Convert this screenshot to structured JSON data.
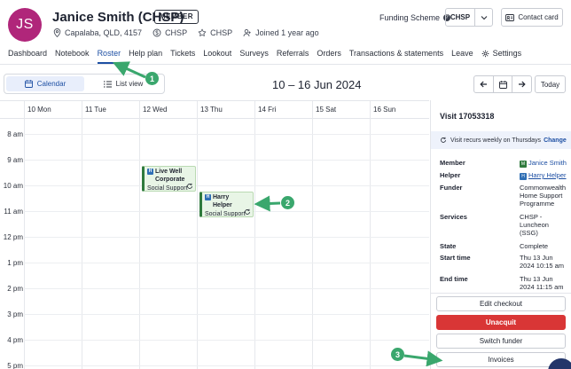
{
  "header": {
    "avatar_initials": "JS",
    "client_name": "Janice Smith (CHSP)",
    "member_badge": "MEMBER",
    "location": "Capalaba, QLD, 4157",
    "program_1": "CHSP",
    "program_2": "CHSP",
    "joined": "Joined 1 year ago",
    "funding_scheme_label": "Funding Scheme",
    "funding_scheme_value": "CHSP",
    "contact_card_label": "Contact card"
  },
  "tabs": [
    {
      "label": "Dashboard"
    },
    {
      "label": "Notebook"
    },
    {
      "label": "Roster",
      "active": true
    },
    {
      "label": "Help plan"
    },
    {
      "label": "Tickets"
    },
    {
      "label": "Lookout"
    },
    {
      "label": "Surveys"
    },
    {
      "label": "Referrals"
    },
    {
      "label": "Orders"
    },
    {
      "label": "Transactions & statements"
    },
    {
      "label": "Leave"
    },
    {
      "label": "Settings"
    }
  ],
  "toolbar": {
    "calendar_label": "Calendar",
    "list_view_label": "List view",
    "date_range": "10 – 16 Jun 2024",
    "today_label": "Today"
  },
  "calendar": {
    "days": [
      "10 Mon",
      "11 Tue",
      "12 Wed",
      "13 Thu",
      "14 Fri",
      "15 Sat",
      "16 Sun"
    ],
    "times": [
      "8 am",
      "9 am",
      "10 am",
      "11 am",
      "12 pm",
      "1 pm",
      "2 pm",
      "3 pm",
      "4 pm",
      "5 pm"
    ],
    "events": [
      {
        "badge": "H",
        "title": "Live Well Corporate",
        "subtitle": "Social Support"
      },
      {
        "badge": "H",
        "title": "Harry Helper",
        "subtitle": "Social Support Group -"
      }
    ]
  },
  "panel": {
    "title": "Visit 17053318",
    "recurrence_text": "Visit recurs weekly on Thursdays",
    "change_label": "Change",
    "details": [
      {
        "key": "Member",
        "value": "Janice Smith",
        "badge": "M"
      },
      {
        "key": "Helper",
        "value": "Harry Helper",
        "badge": "H",
        "link": true
      },
      {
        "key": "Funder",
        "value": "Commonwealth Home Support Programme"
      },
      {
        "key": "Services",
        "value": "CHSP - Luncheon (SSG)"
      },
      {
        "key": "State",
        "value": "Complete"
      },
      {
        "key": "Start time",
        "value": "Thu 13 Jun 2024 10:15 am"
      },
      {
        "key": "End time",
        "value": "Thu 13 Jun 2024 11:15 am"
      }
    ],
    "buttons": {
      "edit_checkout": "Edit checkout",
      "unacquit": "Unacquit",
      "switch_funder": "Switch funder",
      "invoices": "Invoices"
    }
  },
  "annotations": [
    "1",
    "2",
    "3"
  ],
  "colors": {
    "brand_avatar": "#b0267a",
    "accent_blue": "#1d4fa3",
    "event_green": "#2f7a3d",
    "danger_red": "#d93636",
    "callout_green": "#3aa76d"
  }
}
